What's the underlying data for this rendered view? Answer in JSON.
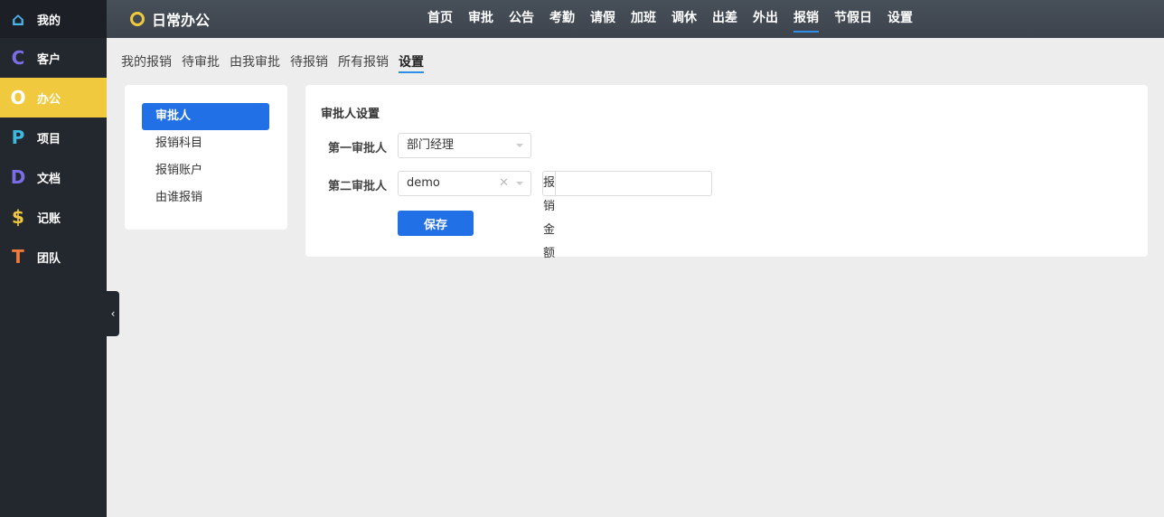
{
  "sidebar": {
    "items": [
      {
        "label": "我的",
        "icon": "home-icon",
        "glyph": "⌂",
        "color": "#4ab3e8"
      },
      {
        "label": "客户",
        "icon": "c-letter-icon",
        "glyph": "C",
        "color": "#7a6ee6"
      },
      {
        "label": "办公",
        "icon": "ring-icon",
        "glyph": "O",
        "color": "#ffffff"
      },
      {
        "label": "项目",
        "icon": "p-letter-icon",
        "glyph": "P",
        "color": "#3db8e0"
      },
      {
        "label": "文档",
        "icon": "d-letter-icon",
        "glyph": "D",
        "color": "#7a6ee6"
      },
      {
        "label": "记账",
        "icon": "dollar-icon",
        "glyph": "$",
        "color": "#f0c93e"
      },
      {
        "label": "团队",
        "icon": "t-letter-icon",
        "glyph": "T",
        "color": "#f07a3a"
      }
    ],
    "active": 2
  },
  "header": {
    "title": "日常办公",
    "nav": [
      "首页",
      "审批",
      "公告",
      "考勤",
      "请假",
      "加班",
      "调休",
      "出差",
      "外出",
      "报销",
      "节假日",
      "设置"
    ],
    "active": 9
  },
  "subtabs": {
    "items": [
      "我的报销",
      "待审批",
      "由我审批",
      "待报销",
      "所有报销",
      "设置"
    ],
    "active": 5
  },
  "settings_menu": {
    "items": [
      "审批人",
      "报销科目",
      "报销账户",
      "由谁报销"
    ],
    "active": 0
  },
  "form": {
    "title": "审批人设置",
    "first_label": "第一审批人",
    "first_value": "部门经理",
    "second_label": "第二审批人",
    "second_value": "demo",
    "amount_label": "报销金额",
    "amount_value": "",
    "clear_glyph": "✕",
    "save_label": "保存"
  },
  "collapse_glyph": "‹"
}
